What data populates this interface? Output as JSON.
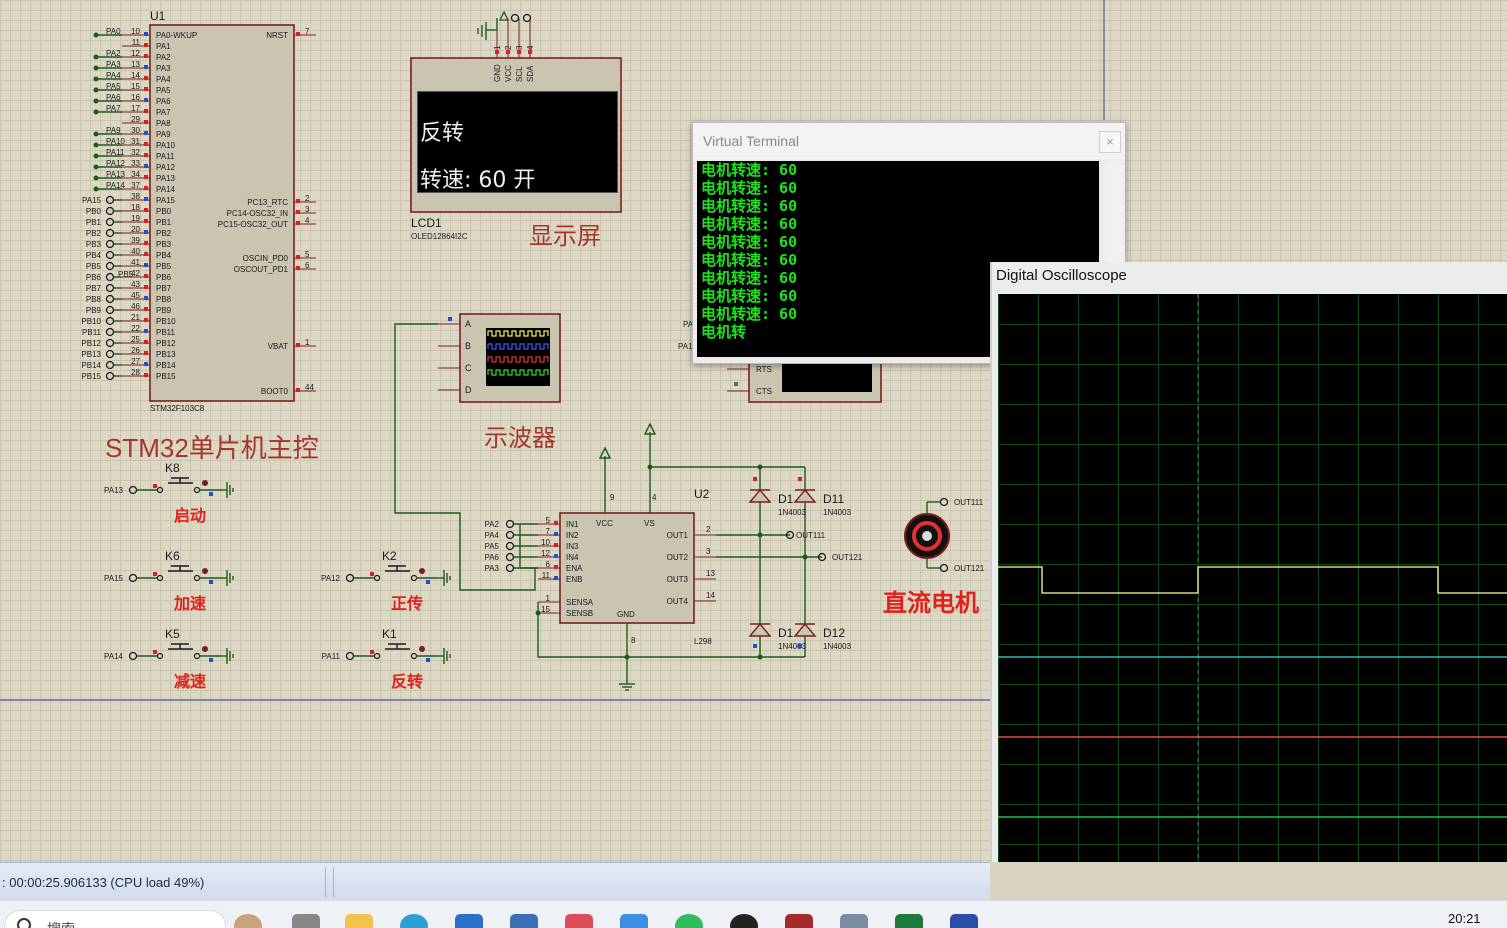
{
  "schematic": {
    "mcu": {
      "ref": "U1",
      "part": "STM32F103C8",
      "left_pins": [
        "PA0-WKUP",
        "PA1",
        "PA2",
        "PA3",
        "PA4",
        "PA5",
        "PA6",
        "PA7",
        "PA8",
        "PA9",
        "PA10",
        "PA11",
        "PA12",
        "PA13",
        "PA14",
        "PA15",
        "PB0",
        "PB1",
        "PB2",
        "PB3",
        "PB4",
        "PB5",
        "PB6",
        "PB7",
        "PB8",
        "PB9",
        "PB10",
        "PB11",
        "PB12",
        "PB13",
        "PB14",
        "PB15"
      ],
      "left_nums": [
        "10",
        "11",
        "12",
        "13",
        "14",
        "15",
        "16",
        "17",
        "29",
        "30",
        "31",
        "32",
        "33",
        "34",
        "37",
        "38",
        "18",
        "19",
        "20",
        "39",
        "40",
        "41",
        "42",
        "43",
        "45",
        "46",
        "21",
        "22",
        "25",
        "26",
        "27",
        "28"
      ],
      "left_nets": [
        "PA0",
        "",
        "PA2",
        "PA3",
        "PA4",
        "PA5",
        "PA6",
        "PA7",
        "",
        "PA9",
        "PA10",
        "PA11",
        "PA12",
        "PA13",
        "PA14",
        "PA15",
        "PB0",
        "PB1",
        "PB2",
        "PB3",
        "PB4",
        "PB5",
        "PB6",
        "PB7",
        "PB8",
        "PB9",
        "PB10",
        "PB11",
        "PB12",
        "PB13",
        "PB14",
        "PB15"
      ],
      "right_pins": [
        {
          "name": "NRST",
          "num": "7"
        },
        {
          "name": "PC13_RTC",
          "num": "2"
        },
        {
          "name": "PC14-OSC32_IN",
          "num": "3"
        },
        {
          "name": "PC15-OSC32_OUT",
          "num": "4"
        },
        {
          "name": "OSCIN_PD0",
          "num": "5"
        },
        {
          "name": "OSCOUT_PD1",
          "num": "6"
        },
        {
          "name": "VBAT",
          "num": "1"
        },
        {
          "name": "BOOT0",
          "num": "44"
        }
      ],
      "caption": "STM32单片机主控"
    },
    "lcd": {
      "ref": "LCD1",
      "part": "OLED12864I2C",
      "pins": [
        "GND",
        "VCC",
        "SCL",
        "SDA"
      ],
      "pin_nums": [
        "1",
        "2",
        "3",
        "4"
      ],
      "line1": "反转",
      "line2": "转速: 60  开",
      "caption": "显示屏"
    },
    "scope_symbol": {
      "channels": [
        "A",
        "B",
        "C",
        "D"
      ],
      "caption": "示波器"
    },
    "terminal_symbol": {
      "pins": [
        "RTS",
        "CTS"
      ],
      "partial": [
        "PA",
        "PA1"
      ]
    },
    "driver": {
      "ref": "U2",
      "part": "L298",
      "inputs": [
        {
          "net": "PA2",
          "pin": "5",
          "name": "IN1"
        },
        {
          "net": "PA4",
          "pin": "7",
          "name": "IN2"
        },
        {
          "net": "PA5",
          "pin": "10",
          "name": "IN3"
        },
        {
          "net": "PA6",
          "pin": "12",
          "name": "IN4"
        },
        {
          "net": "PA3",
          "pin": "6",
          "name": "ENA"
        },
        {
          "net": "",
          "pin": "11",
          "name": "ENB"
        }
      ],
      "sense": [
        {
          "name": "SENSA",
          "pin": "1"
        },
        {
          "name": "SENSB",
          "pin": "15"
        }
      ],
      "top": [
        {
          "name": "VCC",
          "pin": "9"
        },
        {
          "name": "VS",
          "pin": "4"
        }
      ],
      "gnd": {
        "name": "GND",
        "pin": "8"
      },
      "outputs": [
        {
          "name": "OUT1",
          "pin": "2",
          "net": "OUT111"
        },
        {
          "name": "OUT2",
          "pin": "3",
          "net": "OUT121"
        },
        {
          "name": "OUT3",
          "pin": "13",
          "net": ""
        },
        {
          "name": "OUT4",
          "pin": "14",
          "net": ""
        }
      ]
    },
    "diodes": [
      {
        "ref": "D1",
        "part": "1N4003"
      },
      {
        "ref": "D11",
        "part": "1N4003"
      },
      {
        "ref": "D1",
        "part": "1N4003"
      },
      {
        "ref": "D12",
        "part": "1N4003"
      }
    ],
    "motor": {
      "terminals": [
        "OUT111",
        "OUT121"
      ],
      "caption": "直流电机"
    },
    "buttons": [
      {
        "ref": "K8",
        "net": "PA13",
        "caption": "启动"
      },
      {
        "ref": "K6",
        "net": "PA15",
        "caption": "加速"
      },
      {
        "ref": "K5",
        "net": "PA14",
        "caption": "减速"
      },
      {
        "ref": "K2",
        "net": "PA12",
        "caption": "正传"
      },
      {
        "ref": "K1",
        "net": "PA11",
        "caption": "反转"
      }
    ]
  },
  "virtual_terminal": {
    "title": "Virtual Terminal",
    "close": "×",
    "lines": [
      "电机转速: 60",
      "电机转速: 60",
      "电机转速: 60",
      "电机转速: 60",
      "电机转速: 60",
      "电机转速: 60",
      "电机转速: 60",
      "电机转速: 60",
      "电机转速: 60",
      "电机转"
    ]
  },
  "oscilloscope": {
    "title": "Digital Oscilloscope",
    "channel_colors": {
      "A": "#ffff99",
      "B": "#44dddd",
      "C": "#ff6655",
      "D": "#33dd55"
    }
  },
  "status_bar": {
    "text": ": 00:00:25.906133 (CPU load 49%)"
  },
  "taskbar": {
    "search_placeholder": "搜索",
    "time": "20:21"
  }
}
